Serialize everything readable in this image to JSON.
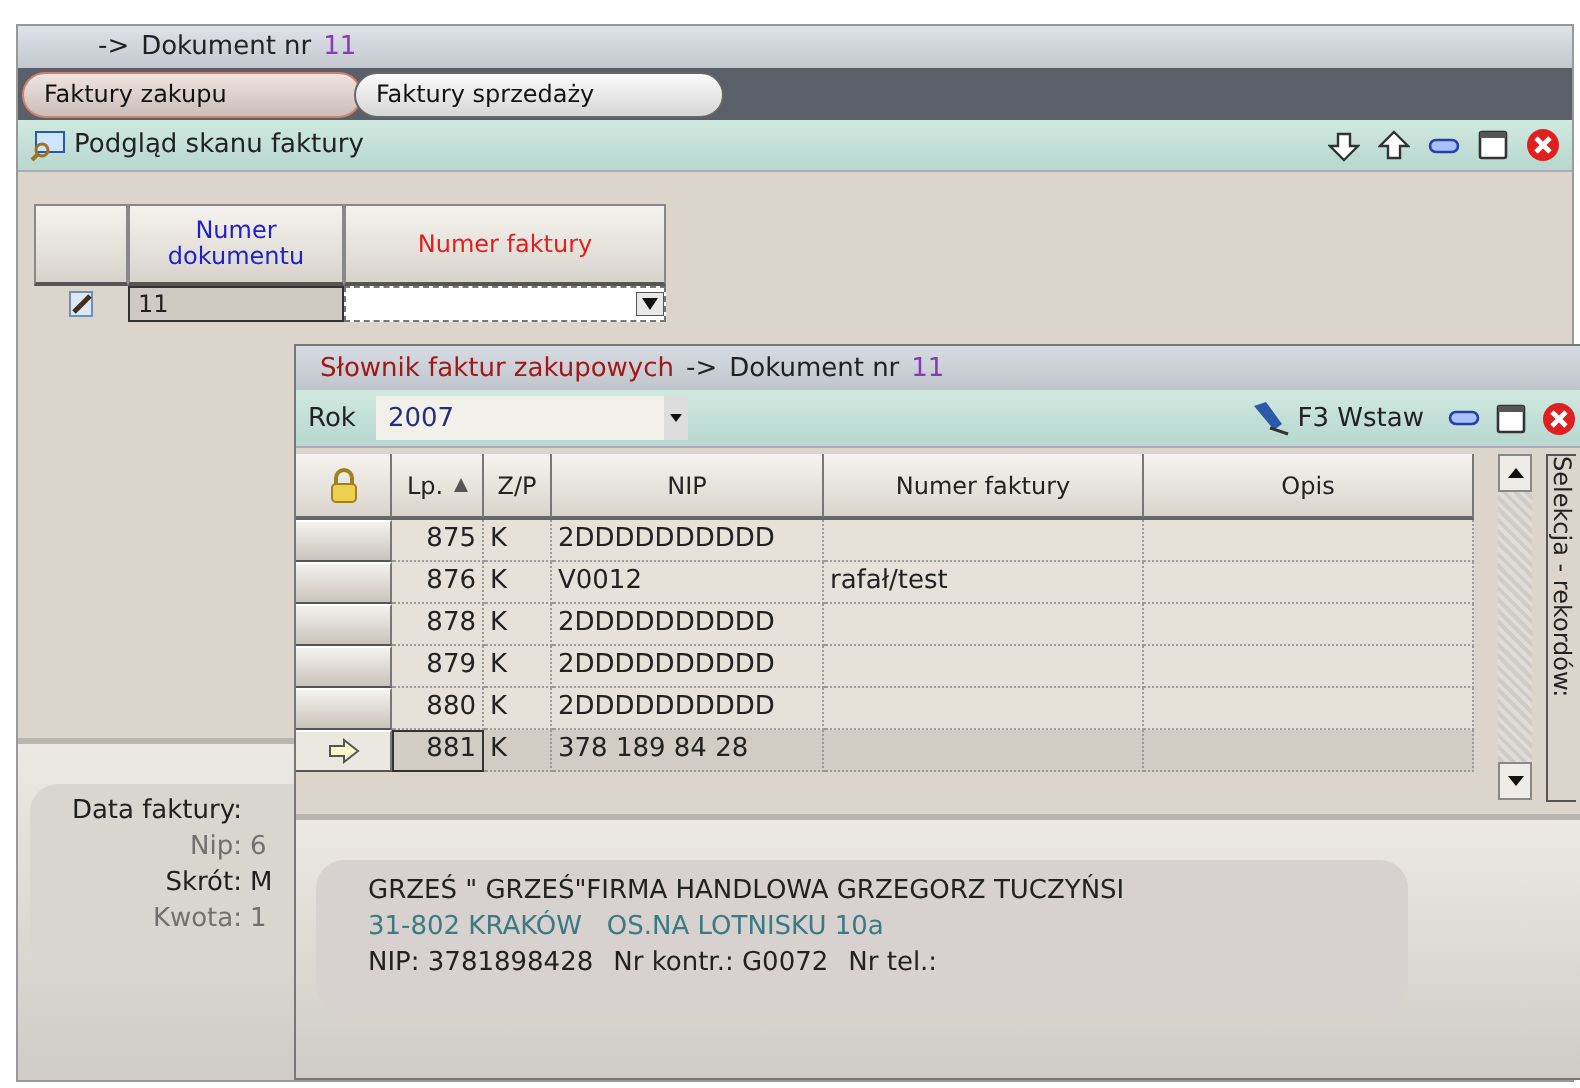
{
  "window": {
    "arrow": "->",
    "title": "Dokument nr",
    "doc_number": "11"
  },
  "tabs": [
    {
      "label": "Faktury zakupu",
      "selected": true
    },
    {
      "label": "Faktury sprzedaży",
      "selected": false
    }
  ],
  "toolbar": {
    "label": "Podgląd skanu faktury"
  },
  "grid": {
    "columns": [
      {
        "label": "Numer dokumentu",
        "color": "#2020c8"
      },
      {
        "label": "Numer faktury",
        "color": "#e02020"
      }
    ],
    "row": {
      "numer_dokumentu": "11"
    }
  },
  "details": [
    {
      "label": "Data faktury:",
      "color": "#202020"
    },
    {
      "label": "Nip:",
      "value": "6",
      "color": "#707070"
    },
    {
      "label": "Skrót:",
      "value": "M",
      "color": "#202020"
    },
    {
      "label": "Kwota:",
      "value": "1",
      "color": "#707070"
    }
  ],
  "dialog": {
    "title": "Słownik faktur zakupowych",
    "arrow": "->",
    "title_suffix": "Dokument nr",
    "doc_number": "11",
    "year_label": "Rok",
    "year": "2007",
    "insert_button": "F3 Wstaw",
    "columns": [
      {
        "label": "Lp.",
        "sorted": true
      },
      {
        "label": "Z/P",
        "sorted": false
      },
      {
        "label": "NIP",
        "sorted": false
      },
      {
        "label": "Numer faktury",
        "sorted": false
      },
      {
        "label": "Opis",
        "sorted": false
      }
    ],
    "rows": [
      {
        "lp": "875",
        "zp": "K",
        "nip": "2DDDDDDDDDD",
        "current": false
      },
      {
        "lp": "876",
        "zp": "K",
        "nip": "V0012",
        "numer_faktury": "rafał/test",
        "current": false
      },
      {
        "lp": "878",
        "zp": "K",
        "nip": "2DDDDDDDDDD",
        "current": false
      },
      {
        "lp": "879",
        "zp": "K",
        "nip": "2DDDDDDDDDD",
        "current": false
      },
      {
        "lp": "880",
        "zp": "K",
        "nip": "2DDDDDDDDDD",
        "current": false
      },
      {
        "lp": "881",
        "zp": "K",
        "nip": "378 189 84 28",
        "current": true
      }
    ],
    "selection_label": "Selekcja - rekordów:",
    "contractor": {
      "name": "GRZEŚ \" GRZEŚ\"FIRMA HANDLOWA GRZEGORZ TUCZYŃSI",
      "address": "31-802 KRAKÓW   OS.NA LOTNISKU 10a",
      "nip": "NIP: 3781898428",
      "contractor_no": "Nr kontr.: G0072",
      "phone": "Nr tel.:"
    }
  }
}
